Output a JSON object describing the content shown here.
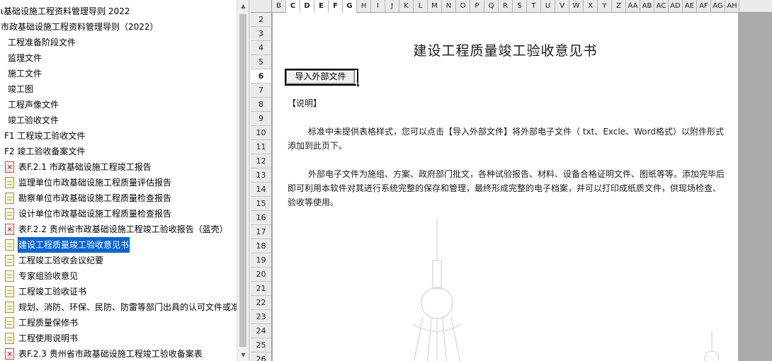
{
  "tree": {
    "items": [
      {
        "label": "ι基础设施工程资料管理导则 2022",
        "icon": "none",
        "selected": false
      },
      {
        "label": "市政基础设施工程资料管理导则（2022）",
        "icon": "none",
        "selected": false
      },
      {
        "label": "工程准备阶段文件",
        "icon": "none",
        "selected": false
      },
      {
        "label": "监理文件",
        "icon": "none",
        "selected": false
      },
      {
        "label": "施工文件",
        "icon": "none",
        "selected": false
      },
      {
        "label": "竣工图",
        "icon": "none",
        "selected": false
      },
      {
        "label": "工程声像文件",
        "icon": "none",
        "selected": false
      },
      {
        "label": "竣工验收文件",
        "icon": "none",
        "selected": false
      },
      {
        "label": "F1 工程竣工验收文件",
        "icon": "none",
        "selected": false
      },
      {
        "label": "F2 竣工验收备案文件",
        "icon": "none",
        "selected": false
      },
      {
        "label": "表F.2.1 市政基础设施工程竣工报告",
        "icon": "red-file-icon",
        "selected": false
      },
      {
        "label": "监理单位市政基础设施工程质量评估报告",
        "icon": "doc-file-icon",
        "selected": false
      },
      {
        "label": "勘察单位市政基础设施工程质量检查报告",
        "icon": "doc-file-icon",
        "selected": false
      },
      {
        "label": "设计单位市政基础设施工程质量检查报告",
        "icon": "doc-file-icon",
        "selected": false
      },
      {
        "label": "表F.2.2 贵州省市政基础设施工程竣工验收报告（蓝壳）",
        "icon": "red-file-icon",
        "selected": false
      },
      {
        "label": "建设工程质量竣工验收意见书",
        "icon": "doc-file-icon",
        "selected": true
      },
      {
        "label": "工程竣工验收会议纪要",
        "icon": "doc-file-icon",
        "selected": false
      },
      {
        "label": "专家组验收意见",
        "icon": "doc-file-icon",
        "selected": false
      },
      {
        "label": "工程竣工验收证书",
        "icon": "doc-file-icon",
        "selected": false
      },
      {
        "label": "规划、消防、环保、民防、防雷等部门出具的认可文件或准",
        "icon": "doc-file-icon",
        "selected": false
      },
      {
        "label": "工程质量保修书",
        "icon": "doc-file-icon",
        "selected": false
      },
      {
        "label": "工程使用说明书",
        "icon": "doc-file-icon",
        "selected": false
      },
      {
        "label": "表F.2.3 贵州省市政基础设施工程竣工验收备案表",
        "icon": "red-file-icon",
        "selected": false
      }
    ]
  },
  "sheet": {
    "columns": [
      "B",
      "C",
      "D",
      "E",
      "F",
      "G",
      "H",
      "I",
      "J",
      "K",
      "L",
      "M",
      "N",
      "O",
      "P",
      "Q",
      "R",
      "S",
      "T",
      "U",
      "V",
      "W",
      "X",
      "Y",
      "Z",
      "AA",
      "AB",
      "AC",
      "AD",
      "AE",
      "AF",
      "AG",
      "AH"
    ],
    "active_columns": [
      "C",
      "D",
      "E",
      "F",
      "G"
    ],
    "rows": [
      "2",
      "3",
      "4",
      "5",
      "6",
      "7",
      "8",
      "9",
      "10",
      "11",
      "12",
      "13",
      "14",
      "15",
      "16",
      "17",
      "18",
      "19",
      "20",
      "21",
      "22",
      "23",
      "24",
      "25",
      "26"
    ],
    "active_row": "6"
  },
  "document": {
    "title": "建设工程质量竣工验收意见书",
    "import_button": "导入外部文件",
    "note_heading": "【说明】",
    "paragraph1": "标准中未提供表格样式，您可以点击【导入外部文件】将外部电子文件（ txt、Excle、Word格式）以附件形式添加到此页下。",
    "paragraph2": "外部电子文件为施组、方案、政府部门批文，各种试验报告、材料、设备合格证明文件、图纸等等。添加完毕后即可利用本软件对其进行系统完整的保存和管理，最终形成完整的电子档案，并可以打印成纸质文件，供现场检查、验收等使用。"
  }
}
